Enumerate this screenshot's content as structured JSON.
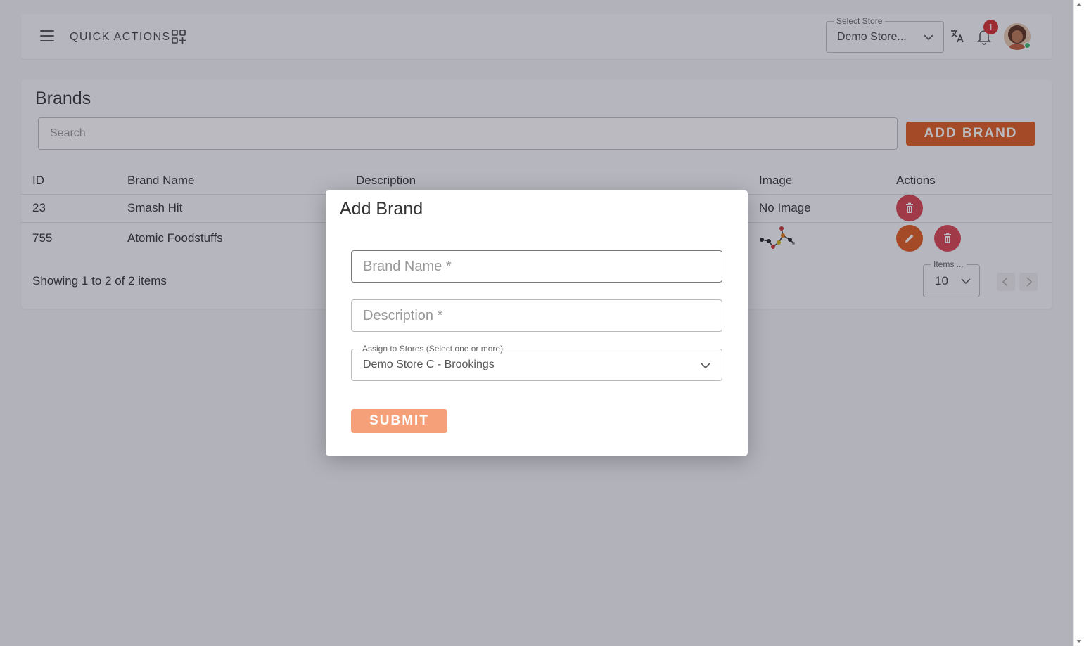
{
  "topbar": {
    "quick_actions_label": "QUICK ACTIONS",
    "store_select_legend": "Select Store",
    "store_select_value": "Demo Store...",
    "notification_count": "1"
  },
  "brands": {
    "title": "Brands",
    "search_placeholder": "Search",
    "add_button": "ADD BRAND",
    "columns": [
      "ID",
      "Brand Name",
      "Description",
      "Image",
      "Actions"
    ],
    "rows": [
      {
        "id": "23",
        "name": "Smash Hit",
        "description": "",
        "image": "No Image"
      },
      {
        "id": "755",
        "name": "Atomic Foodstuffs",
        "description": "",
        "image": ""
      }
    ],
    "showing_text": "Showing 1 to 2 of 2 items",
    "items_legend": "Items ...",
    "items_value": "10"
  },
  "modal": {
    "title": "Add Brand",
    "brand_name_placeholder": "Brand Name *",
    "description_placeholder": "Description *",
    "assign_legend": "Assign to Stores (Select one or more)",
    "assign_value": "Demo Store C - Brookings",
    "submit_label": "SUBMIT"
  },
  "colors": {
    "accent": "#e05a1c",
    "delete": "#d9434e",
    "submit_disabled": "#f6a07a",
    "badge": "#d32f2f"
  },
  "icons": [
    "menu-icon",
    "quick-actions-icon",
    "chevron-down-icon",
    "translate-icon",
    "bell-icon",
    "trash-icon",
    "pencil-icon",
    "chevron-left-icon",
    "chevron-right-icon"
  ]
}
